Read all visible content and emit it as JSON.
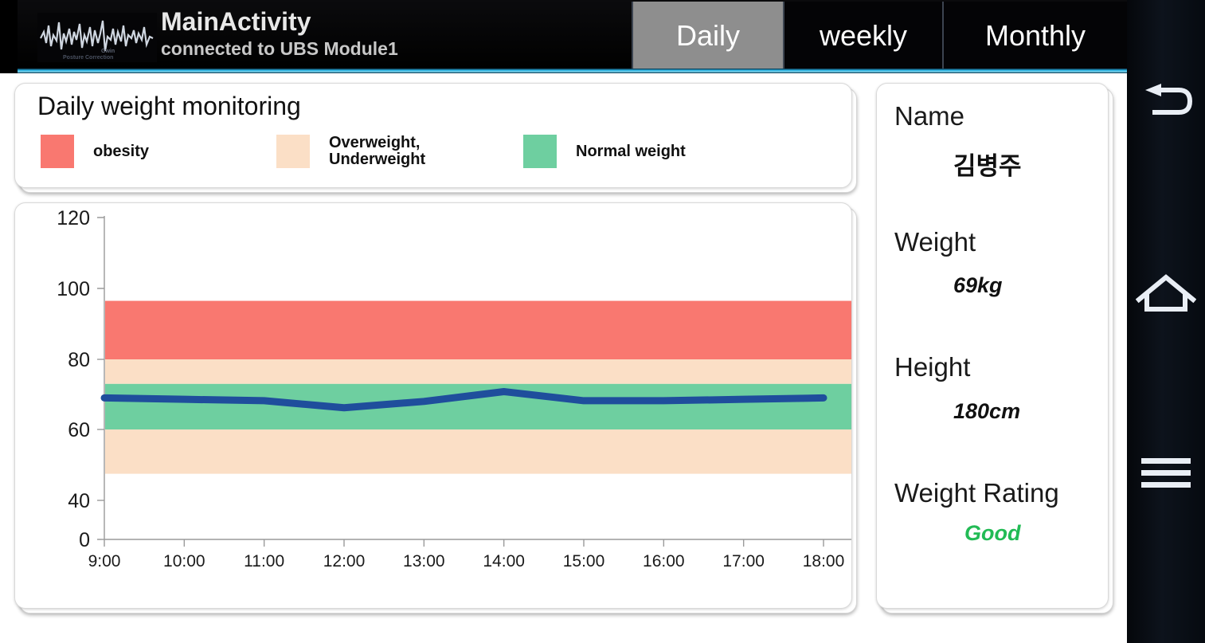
{
  "titlebar": {
    "logo_icon": "waveform-logo-icon",
    "app_title": "MainActivity",
    "app_subtitle": "connected to UBS Module1",
    "tabs": [
      {
        "label": "Daily",
        "selected": true
      },
      {
        "label": "weekly",
        "selected": false
      },
      {
        "label": "Monthly",
        "selected": false
      }
    ],
    "accent_color": "#28b6e8"
  },
  "legend": {
    "title": "Daily weight monitoring",
    "items": [
      {
        "label": "obesity",
        "color": "#F97870"
      },
      {
        "label": "Overweight,\nUnderweight",
        "color": "#FBDFC6"
      },
      {
        "label": "Normal weight",
        "color": "#6ECFA0"
      }
    ]
  },
  "info": {
    "name_label": "Name",
    "name_value": "김병주",
    "weight_label": "Weight",
    "weight_value": "69kg",
    "height_label": "Height",
    "height_value": "180cm",
    "rating_label": "Weight Rating",
    "rating_value": "Good",
    "rating_color": "#22bb55"
  },
  "navbar": {
    "back_icon": "back-arrow-icon",
    "home_icon": "home-icon",
    "menu_icon": "menu-hamburger-icon"
  },
  "chart_data": {
    "type": "line",
    "title": "Daily weight monitoring",
    "xlabel": "",
    "ylabel": "",
    "grid": false,
    "legend_position": "top",
    "x": [
      "9:00",
      "10:00",
      "11:00",
      "12:00",
      "13:00",
      "14:00",
      "15:00",
      "16:00",
      "17:00",
      "18:00"
    ],
    "series": [
      {
        "name": "weight",
        "color": "#1F4E9C",
        "values": [
          69.0,
          68.6,
          68.2,
          66.2,
          68.0,
          70.8,
          68.2,
          68.2,
          68.6,
          69.0
        ]
      }
    ],
    "y_ticks": [
      0,
      40,
      60,
      80,
      100,
      120
    ],
    "ylim": [
      0,
      120
    ],
    "bands": [
      {
        "label": "obesity",
        "from": 80,
        "to": 96.5,
        "color": "#F97870"
      },
      {
        "label": "Overweight",
        "from": 73,
        "to": 80,
        "color": "#FBDFC6"
      },
      {
        "label": "Normal weight",
        "from": 60,
        "to": 73,
        "color": "#6ECFA0"
      },
      {
        "label": "Underweight",
        "from": 47.5,
        "to": 60,
        "color": "#FBDFC6"
      }
    ]
  }
}
